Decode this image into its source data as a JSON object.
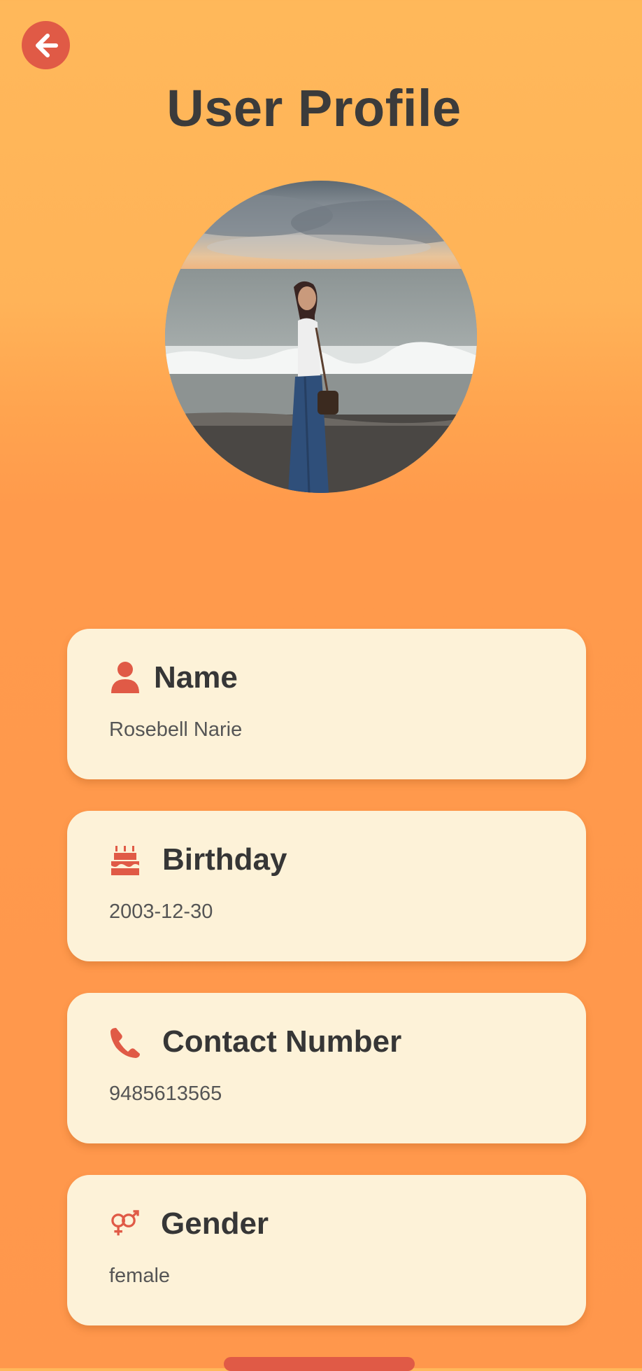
{
  "header": {
    "title": "User Profile",
    "back_icon": "arrow-left-icon"
  },
  "profile": {
    "photo_description_icon": "avatar"
  },
  "cards": [
    {
      "icon": "person-icon",
      "title": "Name",
      "value": "Rosebell Narie"
    },
    {
      "icon": "cake-icon",
      "title": "Birthday",
      "value": "2003-12-30"
    },
    {
      "icon": "phone-icon",
      "title": "Contact Number",
      "value": "9485613565"
    },
    {
      "icon": "gender-icon",
      "title": "Gender",
      "value": "female"
    }
  ],
  "colors": {
    "accent": "#e05a46",
    "card_background": "#fdf2d8",
    "gradient_top": "#ffb85a",
    "gradient_bottom": "#ff974c",
    "title_text": "#3b3b3b"
  }
}
